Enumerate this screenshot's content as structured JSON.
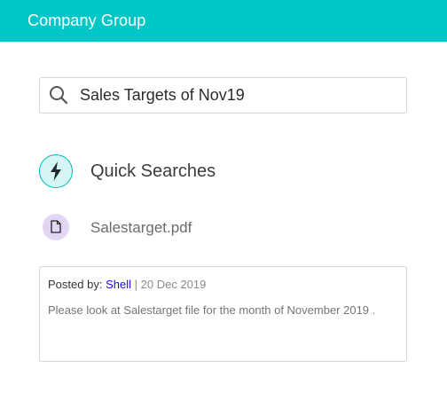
{
  "header": {
    "title": "Company Group"
  },
  "colors": {
    "accent": "#00c7c7",
    "link": "#1a0dcc"
  },
  "search": {
    "icon": "search-icon",
    "value": "Sales Targets of Nov19"
  },
  "quick_searches": {
    "icon": "lightning-bolt-icon",
    "label": "Quick Searches"
  },
  "file": {
    "icon": "document-icon",
    "name": "Salestarget.pdf"
  },
  "post": {
    "posted_by_label": "Posted by:",
    "author": "Shell",
    "separator": "|",
    "date": "20 Dec 2019",
    "body": "Please look at Salestarget file for the month of November 2019 ."
  }
}
